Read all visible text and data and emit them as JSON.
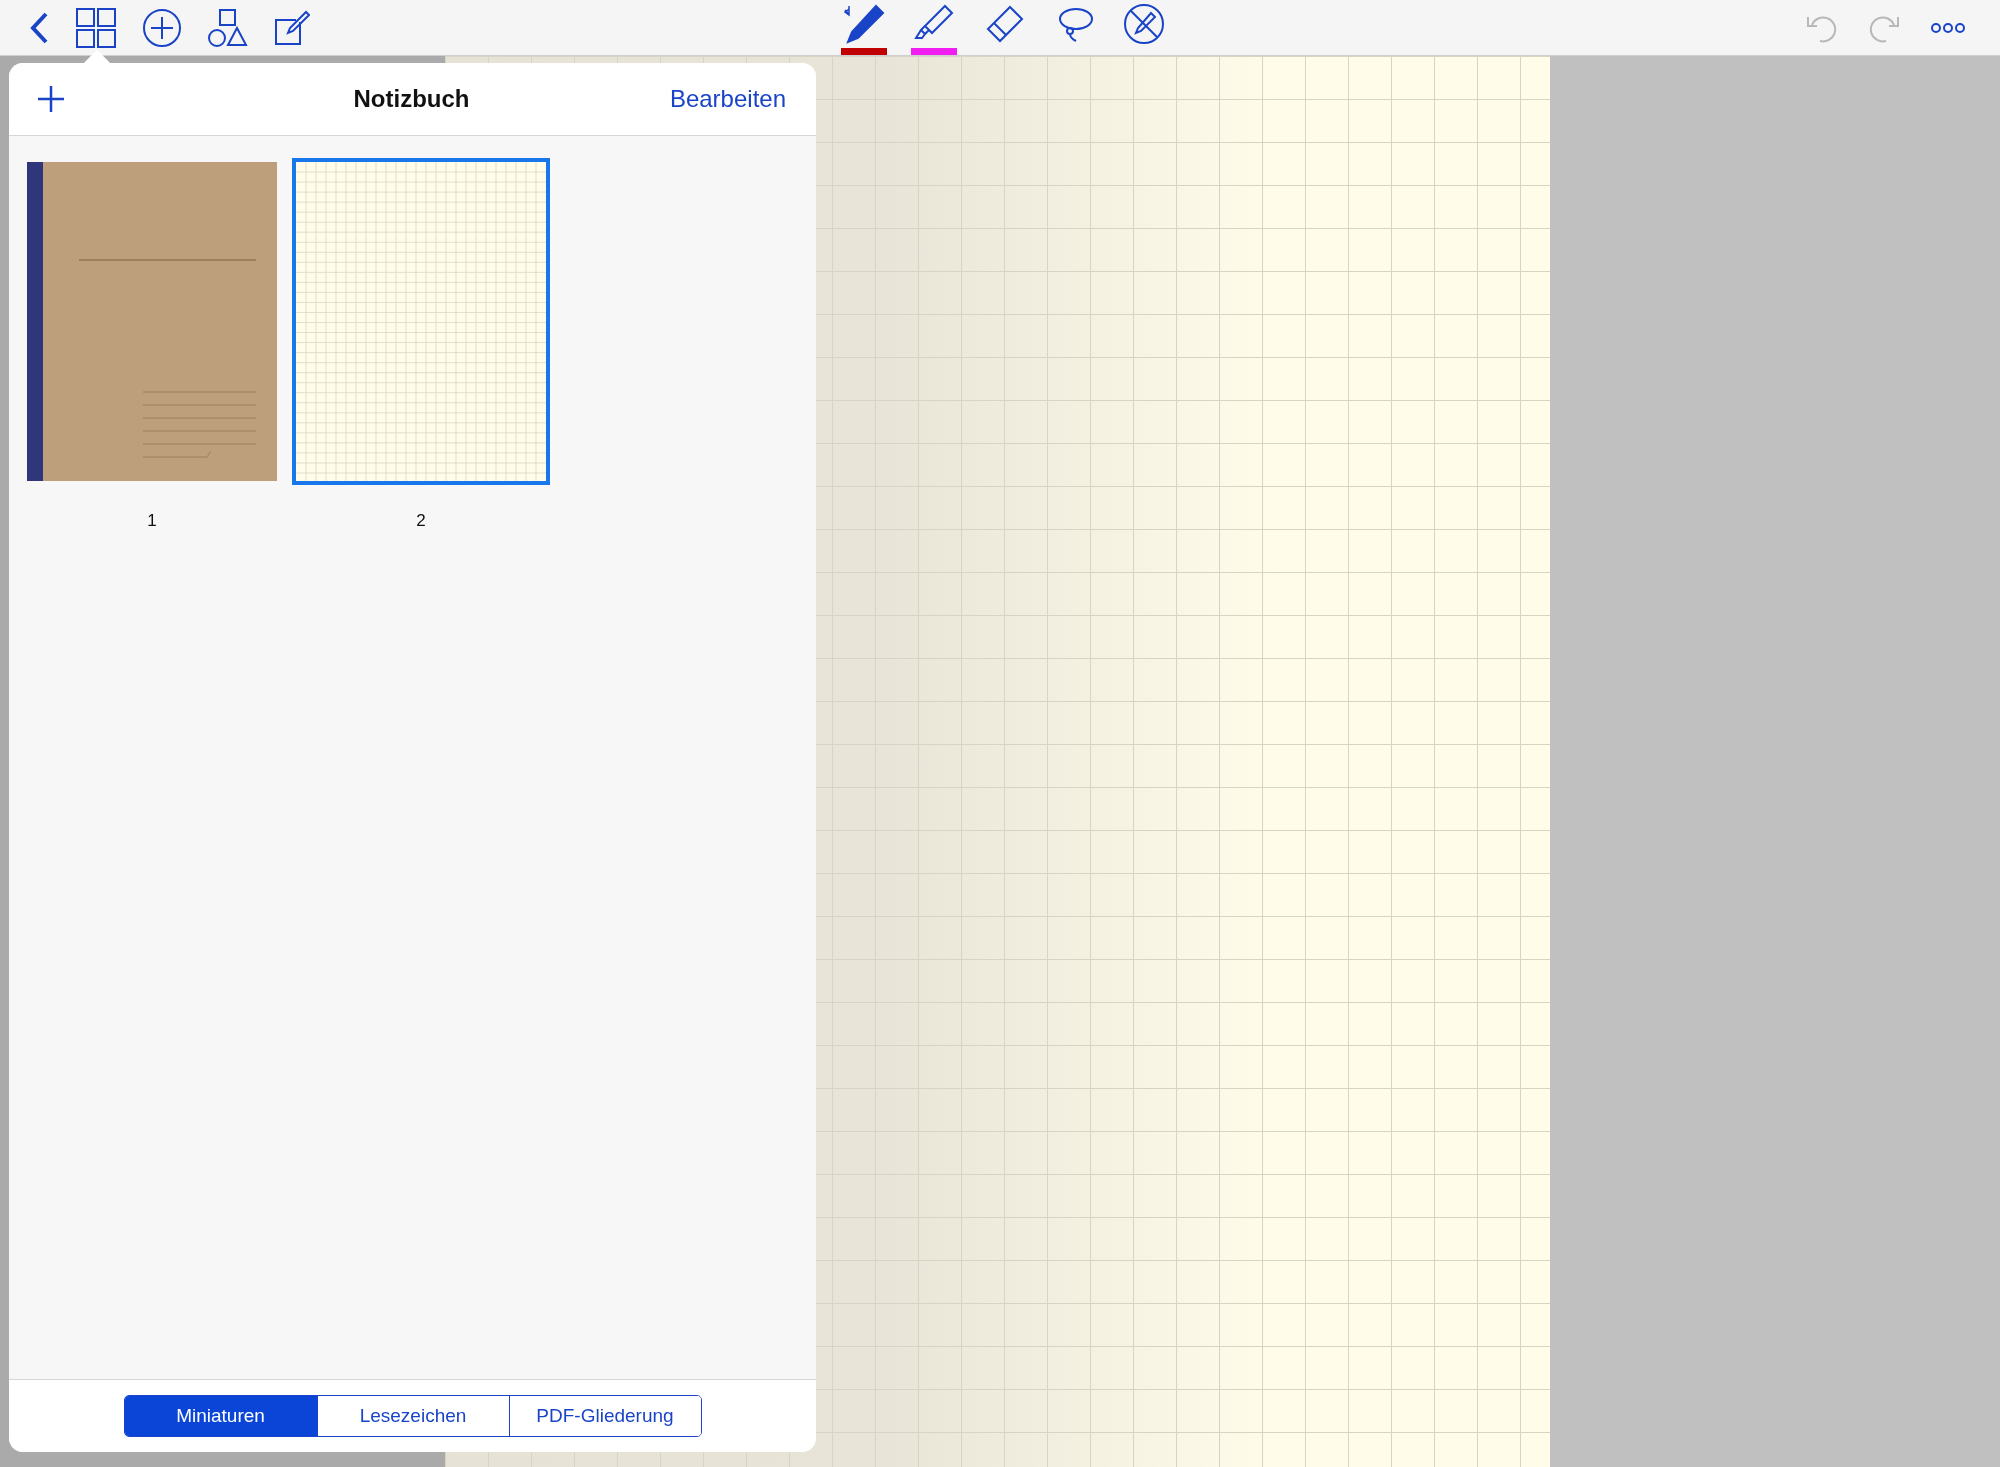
{
  "toolbar": {
    "tools": [
      {
        "kind": "pen",
        "selected": true,
        "color": "#c00000"
      },
      {
        "kind": "highlighter",
        "selected": false,
        "color": "#f01ef0"
      },
      {
        "kind": "eraser",
        "selected": false
      },
      {
        "kind": "lasso",
        "selected": false
      },
      {
        "kind": "no-pen",
        "selected": false
      }
    ],
    "undo": {
      "disabled": true
    },
    "redo": {
      "disabled": true
    }
  },
  "popover": {
    "title": "Notizbuch",
    "edit_button": "Bearbeiten",
    "thumbnails": [
      {
        "kind": "cover",
        "label": "1",
        "selected": false
      },
      {
        "kind": "grid",
        "label": "2",
        "selected": true
      }
    ],
    "segments": [
      {
        "label": "Miniaturen",
        "selected": true
      },
      {
        "label": "Lesezeichen",
        "selected": false
      },
      {
        "label": "PDF-Gliederung",
        "selected": false
      }
    ]
  }
}
